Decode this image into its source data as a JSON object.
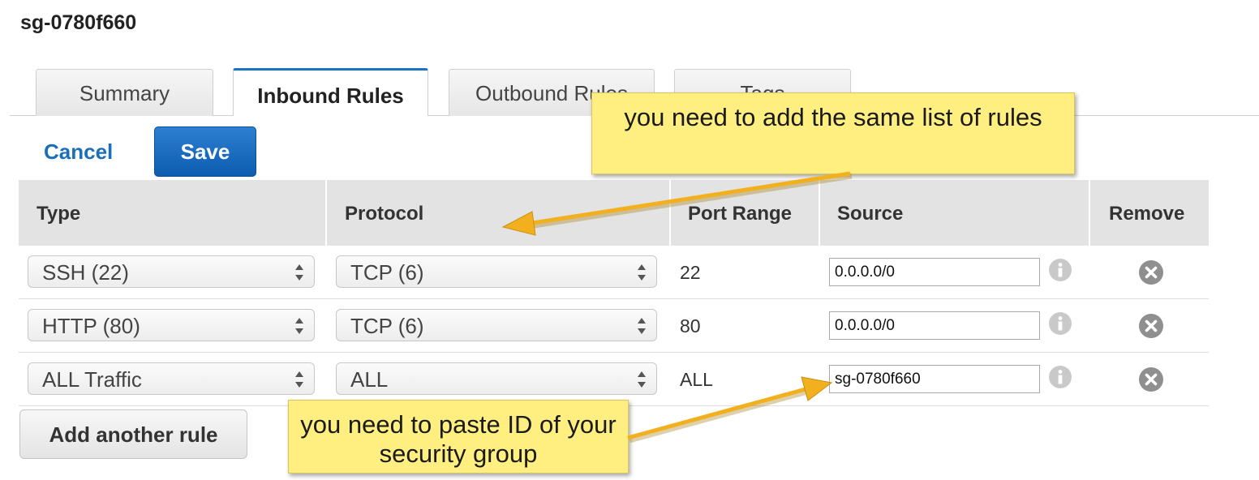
{
  "security_group_id": "sg-0780f660",
  "tabs": [
    {
      "label": "Summary"
    },
    {
      "label": "Inbound Rules"
    },
    {
      "label": "Outbound Rules"
    },
    {
      "label": "Tags"
    }
  ],
  "actions": {
    "cancel_label": "Cancel",
    "save_label": "Save",
    "add_rule_label": "Add another rule"
  },
  "table": {
    "headers": [
      "Type",
      "Protocol",
      "Port Range",
      "Source",
      "Remove"
    ],
    "rows": [
      {
        "type": "SSH (22)",
        "protocol": "TCP (6)",
        "port_range": "22",
        "source": "0.0.0.0/0"
      },
      {
        "type": "HTTP (80)",
        "protocol": "TCP (6)",
        "port_range": "80",
        "source": "0.0.0.0/0"
      },
      {
        "type": "ALL Traffic",
        "protocol": "ALL",
        "port_range": "ALL",
        "source": "sg-0780f660"
      }
    ]
  },
  "annotations": {
    "top": "you need to add the same list of rules",
    "bottom": "you need to paste ID of your security group"
  },
  "colors": {
    "accent": "#1a73c7",
    "note_bg": "#ffef80",
    "arrow": "#f2b01e"
  },
  "icons": [
    "info-icon",
    "remove-icon",
    "select-arrows-icon"
  ]
}
